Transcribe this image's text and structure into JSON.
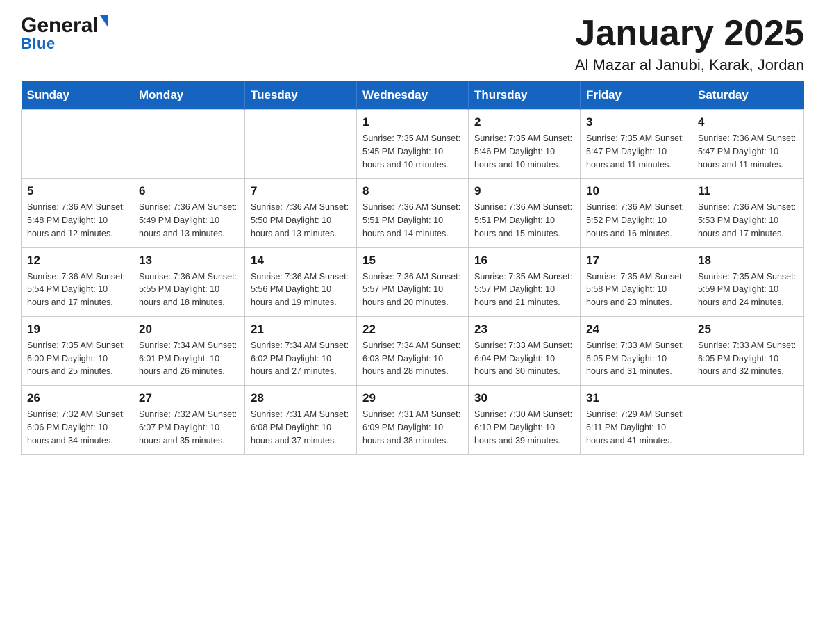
{
  "header": {
    "logo": {
      "general_text": "General",
      "blue_text": "Blue"
    },
    "title": "January 2025",
    "subtitle": "Al Mazar al Janubi, Karak, Jordan"
  },
  "calendar": {
    "days_of_week": [
      "Sunday",
      "Monday",
      "Tuesday",
      "Wednesday",
      "Thursday",
      "Friday",
      "Saturday"
    ],
    "weeks": [
      [
        {
          "day": "",
          "info": ""
        },
        {
          "day": "",
          "info": ""
        },
        {
          "day": "",
          "info": ""
        },
        {
          "day": "1",
          "info": "Sunrise: 7:35 AM\nSunset: 5:45 PM\nDaylight: 10 hours\nand 10 minutes."
        },
        {
          "day": "2",
          "info": "Sunrise: 7:35 AM\nSunset: 5:46 PM\nDaylight: 10 hours\nand 10 minutes."
        },
        {
          "day": "3",
          "info": "Sunrise: 7:35 AM\nSunset: 5:47 PM\nDaylight: 10 hours\nand 11 minutes."
        },
        {
          "day": "4",
          "info": "Sunrise: 7:36 AM\nSunset: 5:47 PM\nDaylight: 10 hours\nand 11 minutes."
        }
      ],
      [
        {
          "day": "5",
          "info": "Sunrise: 7:36 AM\nSunset: 5:48 PM\nDaylight: 10 hours\nand 12 minutes."
        },
        {
          "day": "6",
          "info": "Sunrise: 7:36 AM\nSunset: 5:49 PM\nDaylight: 10 hours\nand 13 minutes."
        },
        {
          "day": "7",
          "info": "Sunrise: 7:36 AM\nSunset: 5:50 PM\nDaylight: 10 hours\nand 13 minutes."
        },
        {
          "day": "8",
          "info": "Sunrise: 7:36 AM\nSunset: 5:51 PM\nDaylight: 10 hours\nand 14 minutes."
        },
        {
          "day": "9",
          "info": "Sunrise: 7:36 AM\nSunset: 5:51 PM\nDaylight: 10 hours\nand 15 minutes."
        },
        {
          "day": "10",
          "info": "Sunrise: 7:36 AM\nSunset: 5:52 PM\nDaylight: 10 hours\nand 16 minutes."
        },
        {
          "day": "11",
          "info": "Sunrise: 7:36 AM\nSunset: 5:53 PM\nDaylight: 10 hours\nand 17 minutes."
        }
      ],
      [
        {
          "day": "12",
          "info": "Sunrise: 7:36 AM\nSunset: 5:54 PM\nDaylight: 10 hours\nand 17 minutes."
        },
        {
          "day": "13",
          "info": "Sunrise: 7:36 AM\nSunset: 5:55 PM\nDaylight: 10 hours\nand 18 minutes."
        },
        {
          "day": "14",
          "info": "Sunrise: 7:36 AM\nSunset: 5:56 PM\nDaylight: 10 hours\nand 19 minutes."
        },
        {
          "day": "15",
          "info": "Sunrise: 7:36 AM\nSunset: 5:57 PM\nDaylight: 10 hours\nand 20 minutes."
        },
        {
          "day": "16",
          "info": "Sunrise: 7:35 AM\nSunset: 5:57 PM\nDaylight: 10 hours\nand 21 minutes."
        },
        {
          "day": "17",
          "info": "Sunrise: 7:35 AM\nSunset: 5:58 PM\nDaylight: 10 hours\nand 23 minutes."
        },
        {
          "day": "18",
          "info": "Sunrise: 7:35 AM\nSunset: 5:59 PM\nDaylight: 10 hours\nand 24 minutes."
        }
      ],
      [
        {
          "day": "19",
          "info": "Sunrise: 7:35 AM\nSunset: 6:00 PM\nDaylight: 10 hours\nand 25 minutes."
        },
        {
          "day": "20",
          "info": "Sunrise: 7:34 AM\nSunset: 6:01 PM\nDaylight: 10 hours\nand 26 minutes."
        },
        {
          "day": "21",
          "info": "Sunrise: 7:34 AM\nSunset: 6:02 PM\nDaylight: 10 hours\nand 27 minutes."
        },
        {
          "day": "22",
          "info": "Sunrise: 7:34 AM\nSunset: 6:03 PM\nDaylight: 10 hours\nand 28 minutes."
        },
        {
          "day": "23",
          "info": "Sunrise: 7:33 AM\nSunset: 6:04 PM\nDaylight: 10 hours\nand 30 minutes."
        },
        {
          "day": "24",
          "info": "Sunrise: 7:33 AM\nSunset: 6:05 PM\nDaylight: 10 hours\nand 31 minutes."
        },
        {
          "day": "25",
          "info": "Sunrise: 7:33 AM\nSunset: 6:05 PM\nDaylight: 10 hours\nand 32 minutes."
        }
      ],
      [
        {
          "day": "26",
          "info": "Sunrise: 7:32 AM\nSunset: 6:06 PM\nDaylight: 10 hours\nand 34 minutes."
        },
        {
          "day": "27",
          "info": "Sunrise: 7:32 AM\nSunset: 6:07 PM\nDaylight: 10 hours\nand 35 minutes."
        },
        {
          "day": "28",
          "info": "Sunrise: 7:31 AM\nSunset: 6:08 PM\nDaylight: 10 hours\nand 37 minutes."
        },
        {
          "day": "29",
          "info": "Sunrise: 7:31 AM\nSunset: 6:09 PM\nDaylight: 10 hours\nand 38 minutes."
        },
        {
          "day": "30",
          "info": "Sunrise: 7:30 AM\nSunset: 6:10 PM\nDaylight: 10 hours\nand 39 minutes."
        },
        {
          "day": "31",
          "info": "Sunrise: 7:29 AM\nSunset: 6:11 PM\nDaylight: 10 hours\nand 41 minutes."
        },
        {
          "day": "",
          "info": ""
        }
      ]
    ]
  }
}
